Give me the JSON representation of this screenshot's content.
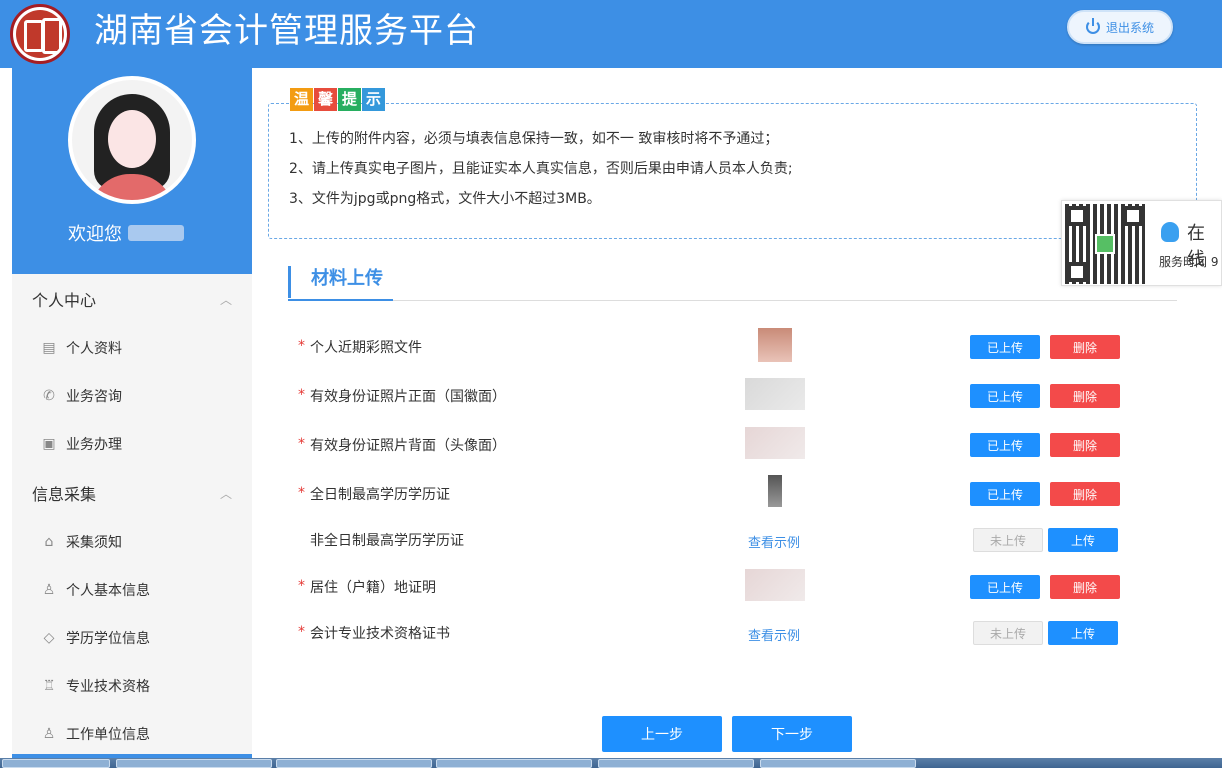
{
  "header": {
    "title": "湖南省会计管理服务平台",
    "logout_label": "退出系统"
  },
  "sidebar": {
    "welcome": "欢迎您",
    "groups": [
      {
        "label": "个人中心",
        "items": [
          {
            "label": "个人资料",
            "icon": "profile-card-icon"
          },
          {
            "label": "业务咨询",
            "icon": "phone-icon"
          },
          {
            "label": "业务办理",
            "icon": "business-icon"
          }
        ]
      },
      {
        "label": "信息采集",
        "items": [
          {
            "label": "采集须知",
            "icon": "inbox-icon"
          },
          {
            "label": "个人基本信息",
            "icon": "user-icon"
          },
          {
            "label": "学历学位信息",
            "icon": "graduation-cap-icon"
          },
          {
            "label": "专业技术资格",
            "icon": "trophy-icon"
          },
          {
            "label": "工作单位信息",
            "icon": "user-work-icon"
          }
        ]
      }
    ]
  },
  "notice": {
    "badge": [
      "温",
      "馨",
      "提",
      "示"
    ],
    "badge_colors": [
      "#f39c12",
      "#e74c3c",
      "#27ae60",
      "#3498db"
    ],
    "lines": [
      "1、上传的附件内容，必须与填表信息保持一致，如不一 致审核时将不予通过；",
      "2、请上传真实电子图片，且能证实本人真实信息，否则后果由申请人员本人负责;",
      "3、文件为jpg或png格式，文件大小不超过3MB。"
    ]
  },
  "support": {
    "online": "在线",
    "service_time": "服务时间 9"
  },
  "section": {
    "title": "材料上传"
  },
  "materials": [
    {
      "label": "个人近期彩照文件",
      "required": true,
      "status": "uploaded"
    },
    {
      "label": "有效身份证照片正面（国徽面）",
      "required": true,
      "status": "uploaded"
    },
    {
      "label": "有效身份证照片背面（头像面）",
      "required": true,
      "status": "uploaded"
    },
    {
      "label": "全日制最高学历学历证",
      "required": true,
      "status": "uploaded"
    },
    {
      "label": "非全日制最高学历学历证",
      "required": false,
      "status": "not_uploaded",
      "example_link": "查看示例"
    },
    {
      "label": "居住（户籍）地证明",
      "required": true,
      "status": "uploaded"
    },
    {
      "label": "会计专业技术资格证书",
      "required": true,
      "status": "not_uploaded",
      "example_link": "查看示例"
    }
  ],
  "buttons": {
    "uploaded": "已上传",
    "delete": "删除",
    "not_uploaded": "未上传",
    "upload": "上传",
    "prev": "上一步",
    "next": "下一步"
  },
  "colors": {
    "primary": "#3d8fe5",
    "button_blue": "#1e90ff",
    "danger": "#f34a4a",
    "required_star": "#e53935"
  }
}
